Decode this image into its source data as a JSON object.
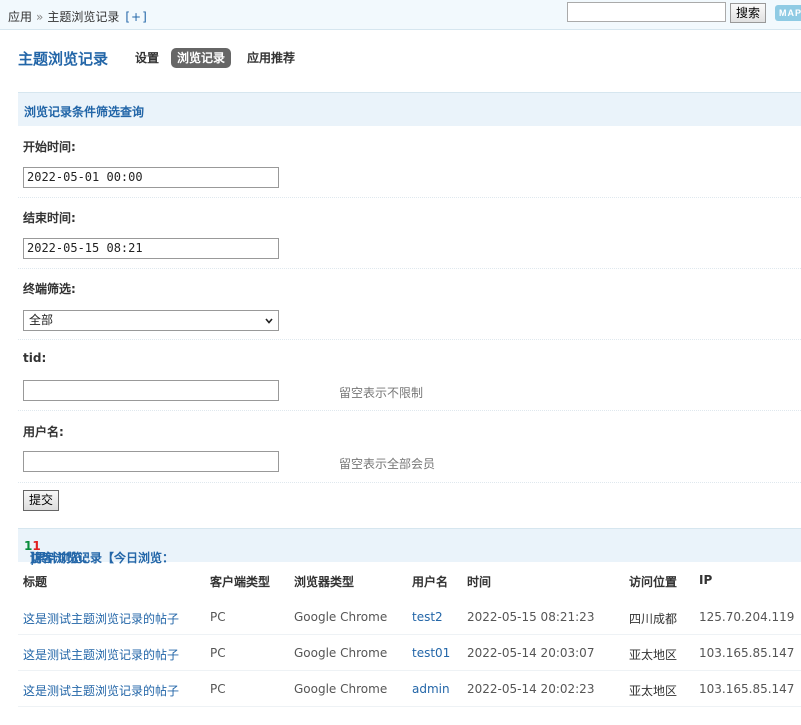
{
  "breadcrumb": {
    "root": "应用",
    "separator": "»",
    "current": "主题浏览记录",
    "add": "[+]"
  },
  "search": {
    "value": "",
    "button": "搜索",
    "map_label": "MAP"
  },
  "header": {
    "title": "主题浏览记录",
    "tabs": [
      {
        "label": "设置",
        "active": false
      },
      {
        "label": "浏览记录",
        "active": true
      },
      {
        "label": "应用推荐",
        "active": false
      }
    ]
  },
  "filter": {
    "heading": "浏览记录条件筛选查询",
    "start_label": "开始时间:",
    "start_value": "2022-05-01 00:00",
    "end_label": "结束时间:",
    "end_value": "2022-05-15 08:21",
    "terminal_label": "终端筛选:",
    "terminal_value": "全部",
    "tid_label": "tid:",
    "tid_value": "",
    "tid_hint": "留空表示不限制",
    "user_label": "用户名:",
    "user_value": "",
    "user_hint": "留空表示全部会员",
    "submit": "提交"
  },
  "records": {
    "heading_prefix": "访客浏览记录【今日浏览：",
    "today_count": "1",
    "heading_mid": "|累计浏览：",
    "total_count": "1",
    "heading_suffix": "】",
    "columns": [
      "标题",
      "客户端类型",
      "浏览器类型",
      "用户名",
      "时间",
      "访问位置",
      "IP"
    ],
    "rows": [
      {
        "title": "这是测试主题浏览记录的帖子",
        "client": "PC",
        "browser": "Google Chrome",
        "user": "test2",
        "time": "2022-05-15 08:21:23",
        "location": "四川成都",
        "ip": "125.70.204.119"
      },
      {
        "title": "这是测试主题浏览记录的帖子",
        "client": "PC",
        "browser": "Google Chrome",
        "user": "test01",
        "time": "2022-05-14 20:03:07",
        "location": "亚太地区",
        "ip": "103.165.85.147"
      },
      {
        "title": "这是测试主题浏览记录的帖子",
        "client": "PC",
        "browser": "Google Chrome",
        "user": "admin",
        "time": "2022-05-14 20:02:23",
        "location": "亚太地区",
        "ip": "103.165.85.147"
      }
    ]
  }
}
